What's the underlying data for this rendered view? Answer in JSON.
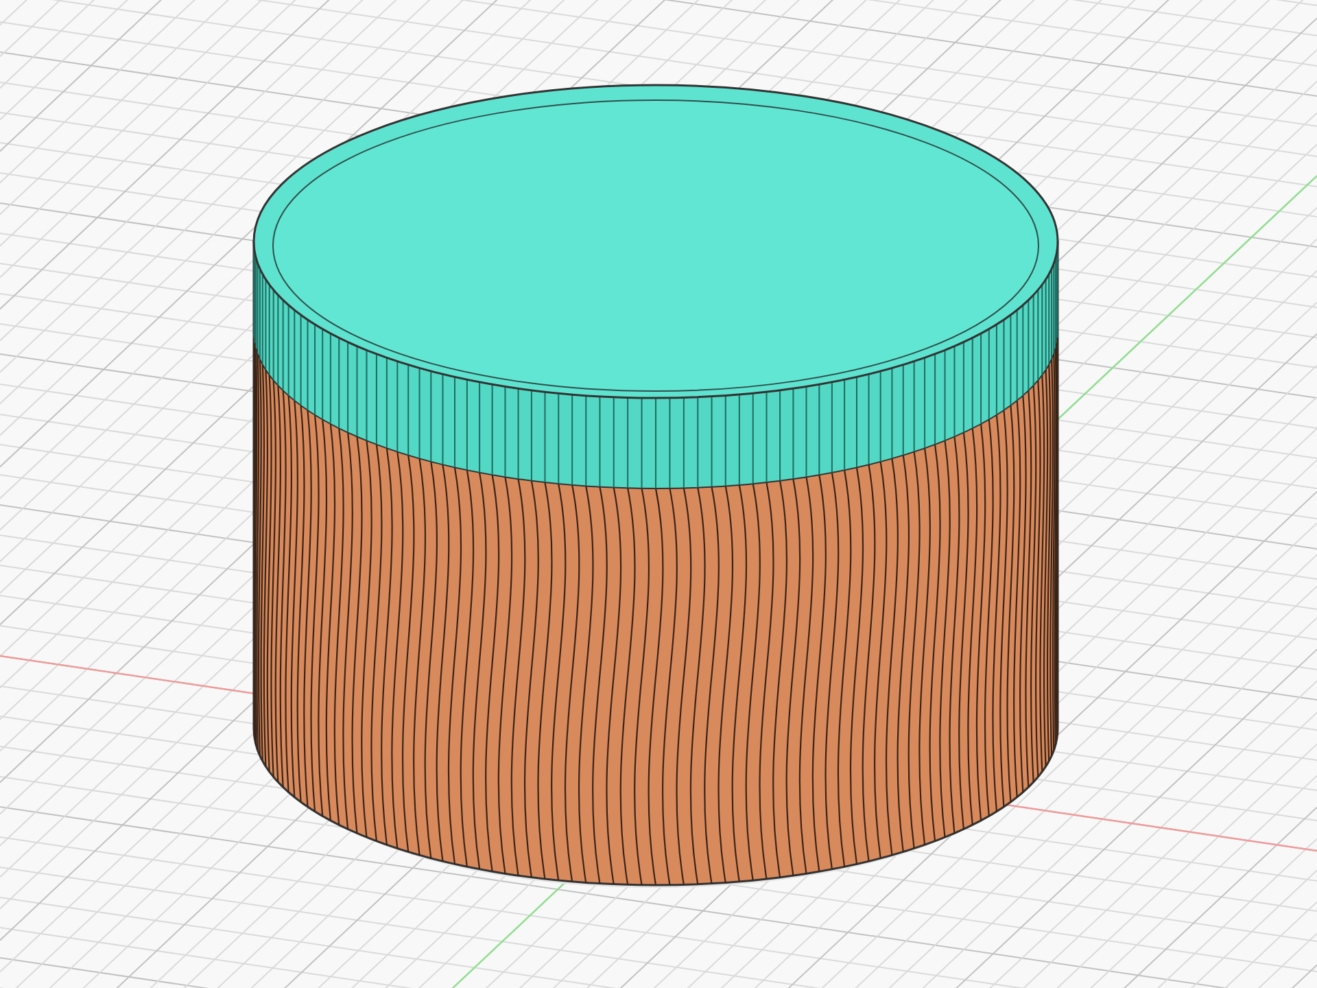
{
  "scene": {
    "kind": "knurled-cylinder"
  }
}
